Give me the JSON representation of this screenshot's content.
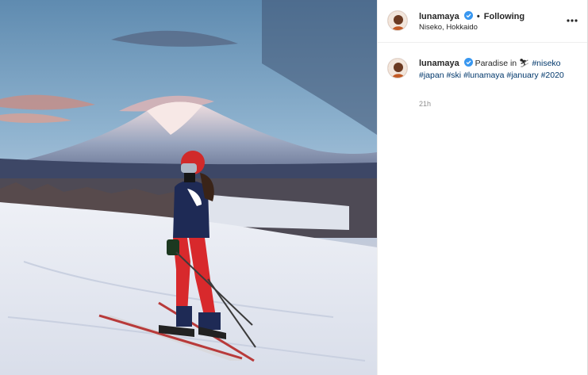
{
  "post": {
    "username": "lunamaya",
    "follow_status": "Following",
    "separator": "•",
    "location": "Niseko, Hokkaido",
    "more_icon": "more-options-icon"
  },
  "caption": {
    "username": "lunamaya",
    "text_before": "Paradise in",
    "emoji": "⛷",
    "hashtags": [
      "#niseko",
      "#japan",
      "#ski",
      "#lunamaya",
      "#january",
      "#2020"
    ],
    "time": "21h"
  },
  "colors": {
    "verified": "#3897f0",
    "hashtag": "#00376b",
    "meta": "#8e8e8e"
  }
}
